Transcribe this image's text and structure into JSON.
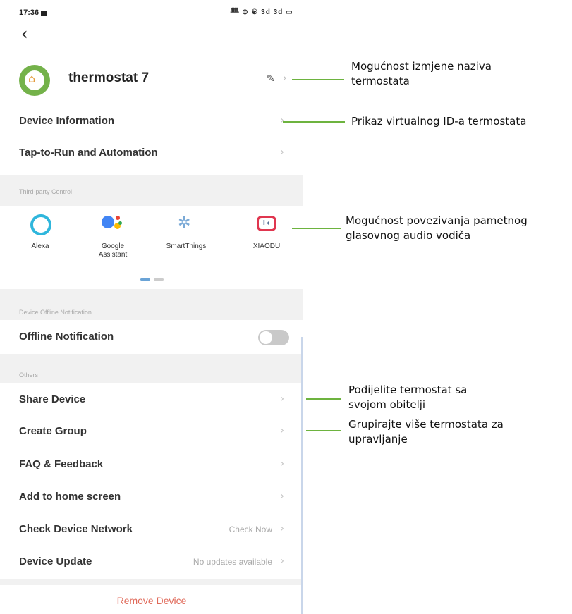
{
  "status_bar": {
    "time": "17:36",
    "icons_text": "ᚙ ⊙ ☯ 3d 3d ▭"
  },
  "header": {
    "back_icon": "chevron-left-icon",
    "device_name": "thermostat 7"
  },
  "menu": {
    "device_information": "Device Information",
    "tap_to_run": "Tap-to-Run and Automation"
  },
  "third_party": {
    "section_title": "Third-party Control",
    "items": [
      {
        "label": "Alexa",
        "icon": "alexa-icon"
      },
      {
        "label": "Google Assistant",
        "icon": "google-assistant-icon"
      },
      {
        "label": "SmartThings",
        "icon": "smartthings-icon"
      },
      {
        "label": "XIAODU",
        "icon": "xiaodu-icon"
      }
    ]
  },
  "offline": {
    "section_title": "Device Offline Notification",
    "label": "Offline Notification",
    "enabled": false
  },
  "others": {
    "section_title": "Others",
    "share_device": "Share Device",
    "create_group": "Create Group",
    "faq": "FAQ & Feedback",
    "add_home": "Add to home screen",
    "check_network": "Check Device Network",
    "check_network_value": "Check Now",
    "device_update": "Device Update",
    "device_update_value": "No updates available"
  },
  "remove_device": "Remove Device",
  "annotations": {
    "rename_1": "Mogućnost izmjene naziva",
    "rename_2": "termostata",
    "virtual_id": "Prikaz virtualnog ID-a termostata",
    "voice_1": "Mogućnost povezivanja pametnog",
    "voice_2": "glasovnog audio vodiča",
    "share_1": "Podijelite termostat sa",
    "share_2": "svojom obitelji",
    "group_1": "Grupirajte više termostata za",
    "group_2": "upravljanje"
  },
  "colors": {
    "annotation_line": "#6db33f",
    "remove_text": "#e06a5a",
    "avatar_green": "#74b24a"
  }
}
